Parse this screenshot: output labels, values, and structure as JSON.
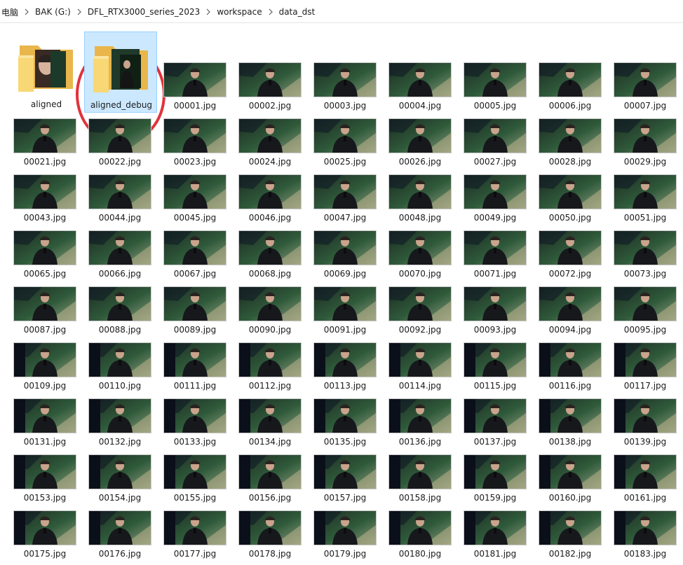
{
  "breadcrumb": {
    "items": [
      {
        "label": "电脑"
      },
      {
        "label": "BAK (G:)"
      },
      {
        "label": "DFL_RTX3000_series_2023"
      },
      {
        "label": "workspace"
      },
      {
        "label": "data_dst"
      }
    ]
  },
  "folders": [
    {
      "name": "aligned",
      "selected": false
    },
    {
      "name": "aligned_debug",
      "selected": true
    }
  ],
  "file_rows": [
    [
      "00001.jpg",
      "00002.jpg",
      "00003.jpg",
      "00004.jpg",
      "00005.jpg",
      "00006.jpg",
      "00007.jpg"
    ],
    [
      "00021.jpg",
      "00022.jpg",
      "00023.jpg",
      "00024.jpg",
      "00025.jpg",
      "00026.jpg",
      "00027.jpg",
      "00028.jpg",
      "00029.jpg"
    ],
    [
      "00043.jpg",
      "00044.jpg",
      "00045.jpg",
      "00046.jpg",
      "00047.jpg",
      "00048.jpg",
      "00049.jpg",
      "00050.jpg",
      "00051.jpg"
    ],
    [
      "00065.jpg",
      "00066.jpg",
      "00067.jpg",
      "00068.jpg",
      "00069.jpg",
      "00070.jpg",
      "00071.jpg",
      "00072.jpg",
      "00073.jpg"
    ],
    [
      "00087.jpg",
      "00088.jpg",
      "00089.jpg",
      "00090.jpg",
      "00091.jpg",
      "00092.jpg",
      "00093.jpg",
      "00094.jpg",
      "00095.jpg"
    ],
    [
      "00109.jpg",
      "00110.jpg",
      "00111.jpg",
      "00112.jpg",
      "00113.jpg",
      "00114.jpg",
      "00115.jpg",
      "00116.jpg",
      "00117.jpg"
    ],
    [
      "00131.jpg",
      "00132.jpg",
      "00133.jpg",
      "00134.jpg",
      "00135.jpg",
      "00136.jpg",
      "00137.jpg",
      "00138.jpg",
      "00139.jpg"
    ],
    [
      "00153.jpg",
      "00154.jpg",
      "00155.jpg",
      "00156.jpg",
      "00157.jpg",
      "00158.jpg",
      "00159.jpg",
      "00160.jpg",
      "00161.jpg"
    ],
    [
      "00175.jpg",
      "00176.jpg",
      "00177.jpg",
      "00178.jpg",
      "00179.jpg",
      "00180.jpg",
      "00181.jpg",
      "00182.jpg",
      "00183.jpg"
    ]
  ],
  "colors": {
    "selection_fill": "#cce8ff",
    "selection_border": "#99d1ff",
    "annotation_red": "#e1333b",
    "folder_yellow": "#f8d775"
  },
  "icons": {
    "breadcrumb_separator": "chevron-right-icon",
    "folder": "folder-icon",
    "image_thumbnail": "image-thumbnail-icon"
  }
}
